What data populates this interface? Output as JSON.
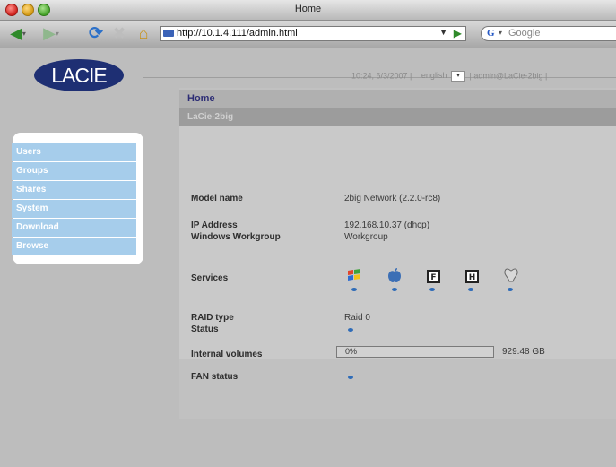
{
  "window": {
    "title": "Home"
  },
  "toolbar": {
    "url": "http://10.1.4.111/admin.html",
    "search_engine": "G",
    "search_placeholder": "Google"
  },
  "header": {
    "brand": "LACIE",
    "info": "10:24, 6/3/2007 |",
    "language": "english",
    "user": "| admin@LaCie-2big |"
  },
  "menu": {
    "items": [
      {
        "label": "Users"
      },
      {
        "label": "Groups"
      },
      {
        "label": "Shares"
      },
      {
        "label": "System"
      },
      {
        "label": "Download"
      },
      {
        "label": "Browse"
      }
    ]
  },
  "main": {
    "section_title": "Home",
    "device_name": "LaCie-2big",
    "model_label": "Model name",
    "model_value": "2big Network (2.2.0-rc8)",
    "ip_label": "IP Address",
    "ip_value": "192.168.10.37 (dhcp)",
    "workgroup_label": "Windows Workgroup",
    "workgroup_value": "Workgroup",
    "services_label": "Services",
    "services": [
      "windows-service",
      "apple-service",
      "ftp-service",
      "http-service",
      "bonjour-service"
    ],
    "raid_label": "RAID type",
    "raid_value": "Raid 0",
    "status_label": "Status",
    "volumes_label": "Internal volumes",
    "volumes_usage": "0%",
    "volumes_usage_fraction": 0.0,
    "volumes_size": "929.48 GB",
    "fan_label": "FAN status"
  },
  "colors": {
    "menu_item": "#a6cdeb",
    "logo": "#1e2f73",
    "status_dot": "#2f6cb8"
  }
}
